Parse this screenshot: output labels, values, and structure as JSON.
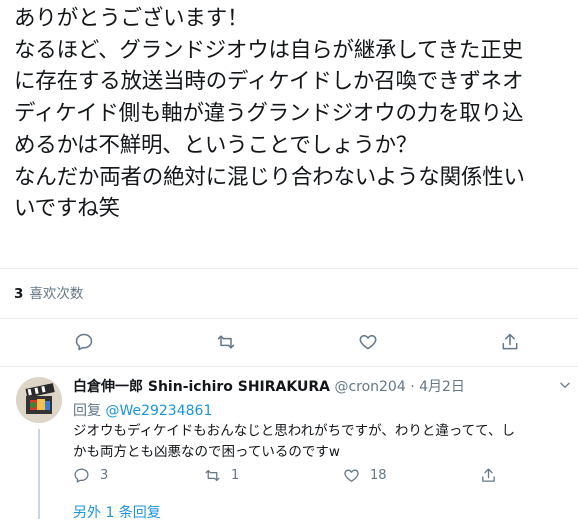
{
  "tweet": {
    "lines": [
      "ありがとうございます！",
      "なるほど、グランドジオウは自らが継承してきた正史",
      "に存在する放送当時のディケイドしか召喚できずネオ",
      "ディケイド側も軸が違うグランドジオウの力を取り込",
      "めるかは不鮮明、ということでしょうか？",
      "なんだか両者の絶対に混じり合わないような関係性い",
      "いですね笑"
    ],
    "like_count": "3",
    "like_label": "喜欢次数"
  },
  "reply": {
    "display_name": "白倉伸一郎 Shin-ichiro SHIRAKURA",
    "handle": "@cron204",
    "separator": "·",
    "date": "4月2日",
    "reply_to_label": "回复",
    "reply_to_handle": "@We29234861",
    "text_lines": [
      "ジオウもディケイドもおんなじと思われがちですが、わりと違ってて、し",
      "かも両方とも凶悪なので困っているのですw"
    ],
    "reply_count": "3",
    "retweet_count": "1",
    "like_count": "18",
    "more_replies": "另外 1 条回复"
  },
  "colors": {
    "text": "#14171a",
    "secondary": "#657786",
    "link": "#1b95e0",
    "divider": "#e6ecf0"
  }
}
